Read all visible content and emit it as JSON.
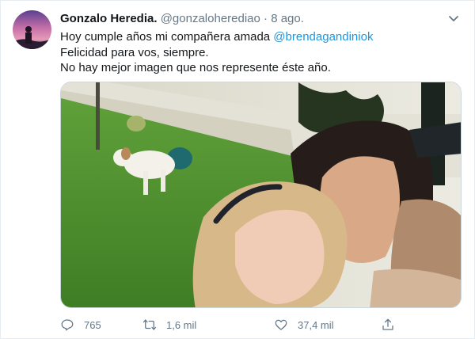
{
  "tweet": {
    "author_name": "Gonzalo Heredia.",
    "handle": "@gonzaloherediao",
    "separator": "·",
    "date": "8 ago.",
    "text": {
      "line1_prefix": "Hoy cumple años mi compañera amada ",
      "line1_mention": "@brendagandiniok",
      "line2": "Felicidad para vos, siempre.",
      "line3": "No hay mejor imagen que nos represente éste año."
    },
    "stats": {
      "replies": "765",
      "retweets": "1,6 mil",
      "likes": "37,4 mil"
    }
  },
  "icons": {
    "caret": "chevron-down-icon",
    "reply": "reply-icon",
    "retweet": "retweet-icon",
    "like": "heart-icon",
    "share": "share-icon"
  },
  "colors": {
    "text": "#14171a",
    "secondary": "#657786",
    "link": "#1b95e0",
    "border": "#e6ecf0"
  }
}
